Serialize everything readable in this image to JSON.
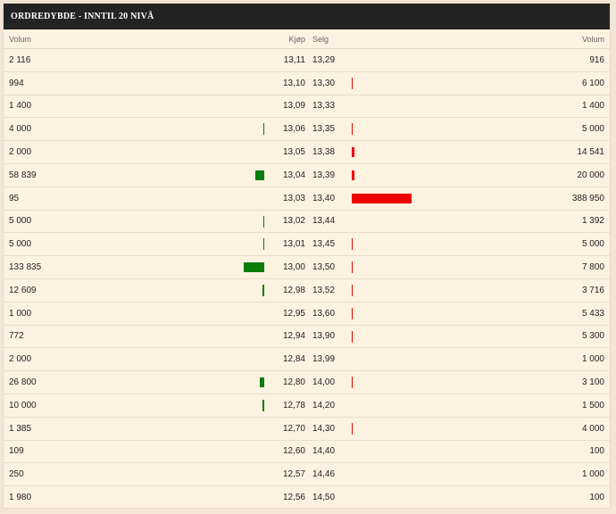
{
  "title": "ORDREDYBDE - INNTIL 20 NIVÅ",
  "headers": {
    "buy_volume": "Volum",
    "buy_price": "Kjøp",
    "sell_price": "Selg",
    "sell_volume": "Volum"
  },
  "colors": {
    "buy_bar": "#0a7c0a",
    "sell_bar": "#ee0000"
  },
  "rows": [
    {
      "bvol": "2 116",
      "bprice": "13,11",
      "sprice": "13,29",
      "svol": "916"
    },
    {
      "bvol": "994",
      "bprice": "13,10",
      "sprice": "13,30",
      "svol": "6 100"
    },
    {
      "bvol": "1 400",
      "bprice": "13,09",
      "sprice": "13,33",
      "svol": "1 400"
    },
    {
      "bvol": "4 000",
      "bprice": "13,06",
      "sprice": "13,35",
      "svol": "5 000"
    },
    {
      "bvol": "2 000",
      "bprice": "13,05",
      "sprice": "13,38",
      "svol": "14 541"
    },
    {
      "bvol": "58 839",
      "bprice": "13,04",
      "sprice": "13,39",
      "svol": "20 000"
    },
    {
      "bvol": "95",
      "bprice": "13,03",
      "sprice": "13,40",
      "svol": "388 950"
    },
    {
      "bvol": "5 000",
      "bprice": "13,02",
      "sprice": "13,44",
      "svol": "1 392"
    },
    {
      "bvol": "5 000",
      "bprice": "13,01",
      "sprice": "13,45",
      "svol": "5 000"
    },
    {
      "bvol": "133 835",
      "bprice": "13,00",
      "sprice": "13,50",
      "svol": "7 800"
    },
    {
      "bvol": "12 609",
      "bprice": "12,98",
      "sprice": "13,52",
      "svol": "3 716"
    },
    {
      "bvol": "1 000",
      "bprice": "12,95",
      "sprice": "13,60",
      "svol": "5 433"
    },
    {
      "bvol": "772",
      "bprice": "12,94",
      "sprice": "13,90",
      "svol": "5 300"
    },
    {
      "bvol": "2 000",
      "bprice": "12,84",
      "sprice": "13,99",
      "svol": "1 000"
    },
    {
      "bvol": "26 800",
      "bprice": "12,80",
      "sprice": "14,00",
      "svol": "3 100"
    },
    {
      "bvol": "10 000",
      "bprice": "12,78",
      "sprice": "14,20",
      "svol": "1 500"
    },
    {
      "bvol": "1 385",
      "bprice": "12,70",
      "sprice": "14,30",
      "svol": "4 000"
    },
    {
      "bvol": "109",
      "bprice": "12,60",
      "sprice": "14,40",
      "svol": "100"
    },
    {
      "bvol": "250",
      "bprice": "12,57",
      "sprice": "14,46",
      "svol": "1 000"
    },
    {
      "bvol": "1 980",
      "bprice": "12,56",
      "sprice": "14,50",
      "svol": "100"
    }
  ]
}
